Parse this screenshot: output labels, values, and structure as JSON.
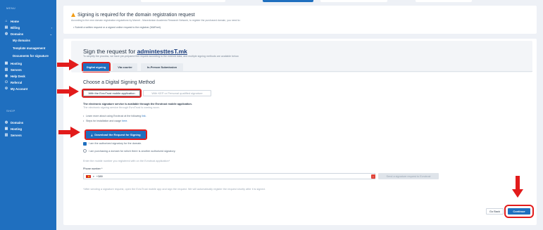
{
  "colors": {
    "sidebar": "#1f6fbf",
    "accent": "#1f6fbf",
    "annotation": "#e21b1b",
    "warning": "#f39c12"
  },
  "sidebar": {
    "menu_label": "MENU",
    "items": [
      {
        "label": "Home",
        "icon": "home-icon"
      },
      {
        "label": "Billing",
        "icon": "billing-icon"
      },
      {
        "label": "Domains",
        "icon": "globe-icon"
      },
      {
        "label": "Hosting",
        "icon": "hosting-icon"
      },
      {
        "label": "Servers",
        "icon": "server-icon"
      },
      {
        "label": "Help Desk",
        "icon": "help-icon"
      },
      {
        "label": "Referral",
        "icon": "referral-icon"
      },
      {
        "label": "My Account",
        "icon": "account-icon"
      }
    ],
    "domain_subitems": [
      "My domains",
      "Template management",
      "Documents for signature"
    ],
    "shop_label": "SHOP",
    "shop_items": [
      {
        "label": "Domains",
        "icon": "globe-icon"
      },
      {
        "label": "Hosting",
        "icon": "hosting-icon"
      },
      {
        "label": "Servers",
        "icon": "server-icon"
      }
    ]
  },
  "notice": {
    "title": "Signing is required for the domain registration request",
    "subtitle": "According to the new domain registration regulations by Marnet - Macedonian Academic Research Network, to register the purchased domain, you need to:",
    "bullet": "Submit a written request or a signed online request to the registrar (MARnet)."
  },
  "sign": {
    "title_prefix": "Sign the request for",
    "domain": "admintesttesT.mk",
    "subtitle": "To simplify the process, we have pre-prepared the request according to the entered data, and multiple signing methods are available below.",
    "tabs": [
      "Digital signing",
      "Via courier",
      "In-Person Submission"
    ]
  },
  "method": {
    "title": "Choose a Digital Signing Method",
    "options": [
      "With the EvroTrust mobile application",
      "With KEP or Personal qualified signature"
    ],
    "desc_bold": "The electronic signature service is available through the Evrotrust mobile application.",
    "desc_muted": "The electronic signing service through EvroTrust is coming soon.",
    "bullets": [
      {
        "text": "Learn more about using Evrotrust at the following",
        "link": "link."
      },
      {
        "text": "Steps for installation and usage",
        "link": "here."
      }
    ],
    "download_label": "Download the Request for Signing",
    "radio_options": [
      "I am the authorized signatory for the domain.",
      "I am purchasing a domain for which there is another authorized signatory."
    ],
    "phone_prompt": "Enter the mobile number you registered with on the Evrotrust application*",
    "phone_label": "Phone number *",
    "phone_value": "+389",
    "send_label": "Send a signature request to Evrotrust",
    "after_note": "*After sending a signature request, open the EvroTrust mobile app and sign the request. We will automatically register the request shortly after it is signed."
  },
  "footer": {
    "back_label": "Go Back",
    "continue_label": "Continue"
  }
}
